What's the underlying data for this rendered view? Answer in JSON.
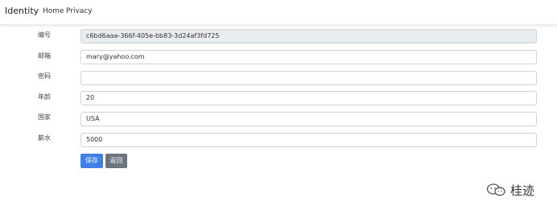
{
  "nav": {
    "brand": "Identity",
    "home": "Home",
    "privacy": "Privacy"
  },
  "form": {
    "id": {
      "label": "编号",
      "value": "c6bd6aaa-366f-405e-bb83-3d24af3fd725"
    },
    "email": {
      "label": "邮箱",
      "value": "mary@yahoo.com"
    },
    "password": {
      "label": "密码",
      "value": ""
    },
    "age": {
      "label": "年龄",
      "value": "20"
    },
    "country": {
      "label": "国家",
      "value": "USA"
    },
    "salary": {
      "label": "薪水",
      "value": "5000"
    }
  },
  "buttons": {
    "save": "保存",
    "back": "返回"
  },
  "watermark": {
    "text": "桂迹",
    "icon": "wechat-icon"
  }
}
